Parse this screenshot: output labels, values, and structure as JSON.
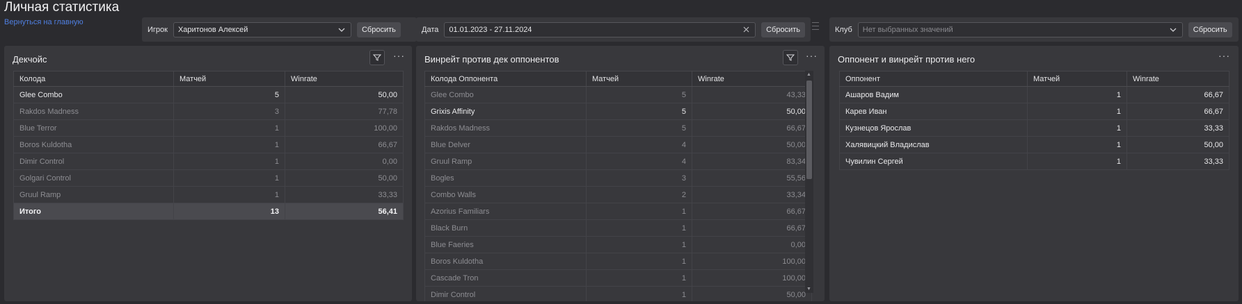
{
  "page": {
    "title": "Личная статистика",
    "back_link": "Вернуться на главную"
  },
  "filters": {
    "player": {
      "label": "Игрок",
      "value": "Харитонов Алексей",
      "reset": "Сбросить"
    },
    "date": {
      "label": "Дата",
      "value": "01.01.2023 - 27.11.2024",
      "reset": "Сбросить"
    },
    "club": {
      "label": "Клуб",
      "placeholder": "Нет выбранных значений",
      "reset": "Сбросить"
    }
  },
  "panels": {
    "deckchoice": {
      "title": "Декчойс",
      "columns": [
        "Колода",
        "Матчей",
        "Winrate"
      ],
      "rows": [
        {
          "deck": "Glee Combo",
          "matches": "5",
          "winrate": "50,00",
          "dim": false
        },
        {
          "deck": "Rakdos Madness",
          "matches": "3",
          "winrate": "77,78",
          "dim": true
        },
        {
          "deck": "Blue Terror",
          "matches": "1",
          "winrate": "100,00",
          "dim": true
        },
        {
          "deck": "Boros Kuldotha",
          "matches": "1",
          "winrate": "66,67",
          "dim": true
        },
        {
          "deck": "Dimir Control",
          "matches": "1",
          "winrate": "0,00",
          "dim": true
        },
        {
          "deck": "Golgari Control",
          "matches": "1",
          "winrate": "50,00",
          "dim": true
        },
        {
          "deck": "Gruul Ramp",
          "matches": "1",
          "winrate": "33,33",
          "dim": true
        }
      ],
      "total": {
        "label": "Итого",
        "matches": "13",
        "winrate": "56,41"
      }
    },
    "opponent_decks": {
      "title": "Винрейт против дек оппонентов",
      "columns": [
        "Колода Оппонента",
        "Матчей",
        "Winrate"
      ],
      "rows": [
        {
          "deck": "Glee Combo",
          "matches": "5",
          "winrate": "43,33",
          "dim": true
        },
        {
          "deck": "Grixis Affinity",
          "matches": "5",
          "winrate": "50,00",
          "dim": false
        },
        {
          "deck": "Rakdos Madness",
          "matches": "5",
          "winrate": "66,67",
          "dim": true
        },
        {
          "deck": "Blue Delver",
          "matches": "4",
          "winrate": "50,00",
          "dim": true
        },
        {
          "deck": "Gruul Ramp",
          "matches": "4",
          "winrate": "83,34",
          "dim": true
        },
        {
          "deck": "Bogles",
          "matches": "3",
          "winrate": "55,56",
          "dim": true
        },
        {
          "deck": "Combo Walls",
          "matches": "2",
          "winrate": "33,34",
          "dim": true
        },
        {
          "deck": "Azorius Familiars",
          "matches": "1",
          "winrate": "66,67",
          "dim": true
        },
        {
          "deck": "Black Burn",
          "matches": "1",
          "winrate": "66,67",
          "dim": true
        },
        {
          "deck": "Blue Faeries",
          "matches": "1",
          "winrate": "0,00",
          "dim": true
        },
        {
          "deck": "Boros Kuldotha",
          "matches": "1",
          "winrate": "100,00",
          "dim": true
        },
        {
          "deck": "Cascade Tron",
          "matches": "1",
          "winrate": "100,00",
          "dim": true
        },
        {
          "deck": "Dimir Control",
          "matches": "1",
          "winrate": "50,00",
          "dim": true
        }
      ]
    },
    "opponents": {
      "title": "Оппонент и винрейт против него",
      "columns": [
        "Оппонент",
        "Матчей",
        "Winrate"
      ],
      "rows": [
        {
          "name": "Ашаров Вадим",
          "matches": "1",
          "winrate": "66,67"
        },
        {
          "name": "Карев Иван",
          "matches": "1",
          "winrate": "66,67"
        },
        {
          "name": "Кузнецов Ярослав",
          "matches": "1",
          "winrate": "33,33"
        },
        {
          "name": "Халявицкий Владислав",
          "matches": "1",
          "winrate": "50,00"
        },
        {
          "name": "Чувилин Сергей",
          "matches": "1",
          "winrate": "33,33"
        }
      ]
    }
  },
  "icons": {
    "chevron": "chevron-down-icon",
    "clear": "close-icon",
    "filter": "filter-funnel-icon",
    "more": "more-horizontal-icon"
  }
}
